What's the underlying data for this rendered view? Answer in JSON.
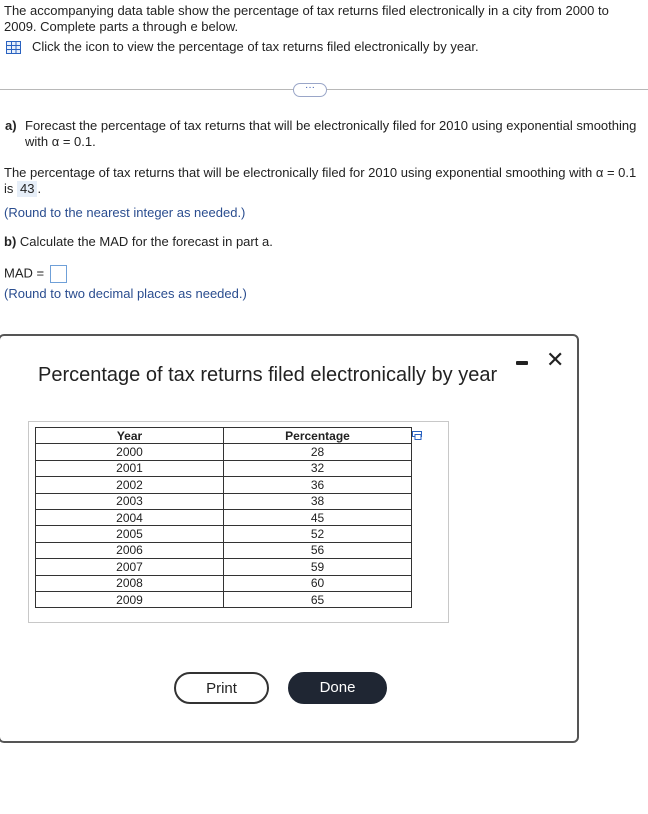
{
  "intro": {
    "text": "The accompanying data table show the percentage of tax returns filed electronically in a city from 2000 to 2009. Complete parts a through e below.",
    "icon_text": "Click the icon to view the percentage of tax returns filed electronically by year.",
    "icon": "table-grid-icon"
  },
  "more_button": "···",
  "part_a": {
    "label": "a)",
    "question": "Forecast the percentage of tax returns that will be electronically filed for 2010 using exponential smoothing with α = 0.1.",
    "answer_prefix": "The percentage of tax returns that will be electronically filed for 2010 using exponential smoothing with α = 0.1 is",
    "answer_value": "43",
    "answer_suffix": ".",
    "round_note": "(Round to the nearest integer as needed.)"
  },
  "part_b": {
    "label": "b)",
    "question": "Calculate the MAD for the forecast in part a.",
    "mad_label": "MAD =",
    "mad_value": "",
    "round_note": "(Round to two decimal places as needed.)"
  },
  "modal": {
    "title": "Percentage of tax returns filed electronically by year",
    "columns": [
      "Year",
      "Percentage"
    ],
    "rows": [
      [
        "2000",
        "28"
      ],
      [
        "2001",
        "32"
      ],
      [
        "2002",
        "36"
      ],
      [
        "2003",
        "38"
      ],
      [
        "2004",
        "45"
      ],
      [
        "2005",
        "52"
      ],
      [
        "2006",
        "56"
      ],
      [
        "2007",
        "59"
      ],
      [
        "2008",
        "60"
      ],
      [
        "2009",
        "65"
      ]
    ],
    "print_label": "Print",
    "done_label": "Done"
  }
}
